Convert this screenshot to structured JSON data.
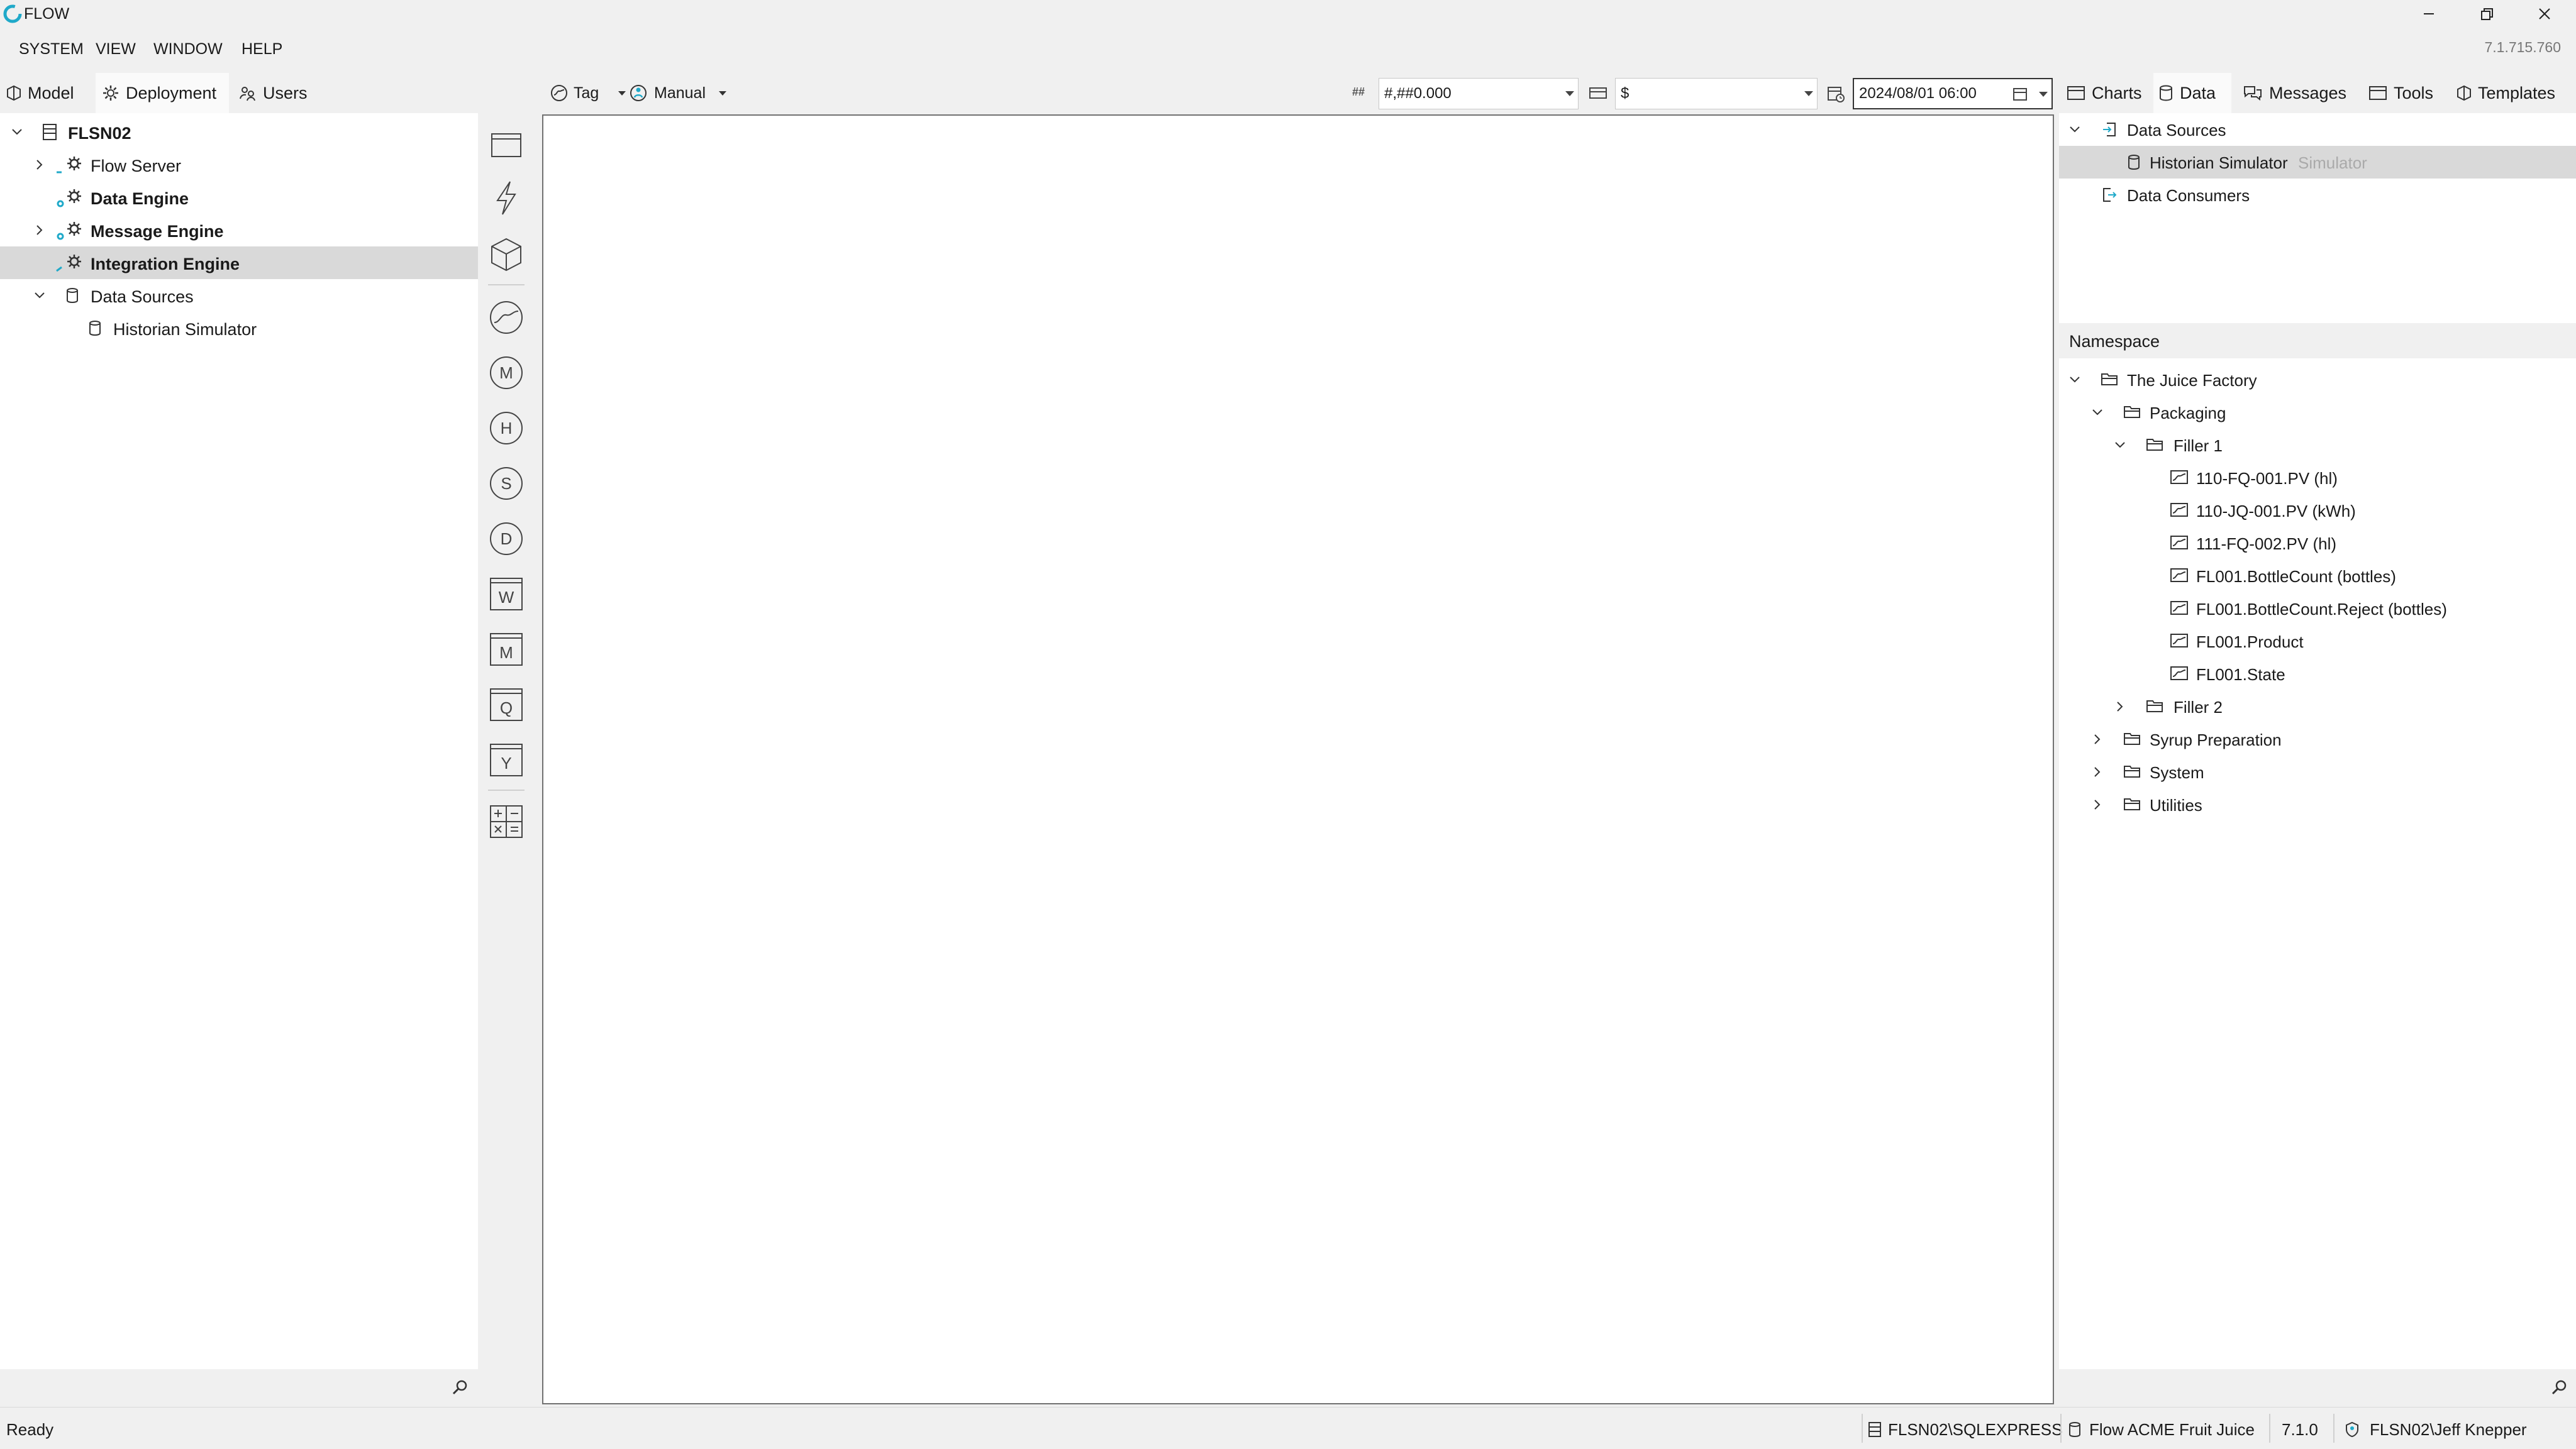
{
  "window": {
    "title": "FLOW",
    "version": "7.1.715.760"
  },
  "menu": [
    "SYSTEM",
    "VIEW",
    "WINDOW",
    "HELP"
  ],
  "left_tabs": [
    "Model",
    "Deployment",
    "Users"
  ],
  "left_tree": [
    {
      "label": "FLSN02",
      "bold": true
    },
    {
      "label": "Flow Server",
      "bold": false
    },
    {
      "label": "Data Engine",
      "bold": true
    },
    {
      "label": "Message Engine",
      "bold": true
    },
    {
      "label": "Integration Engine",
      "bold": true,
      "selected": true
    },
    {
      "label": "Data Sources",
      "bold": false
    },
    {
      "label": "Historian Simulator",
      "bold": false
    }
  ],
  "toolbar": {
    "tag_label": "Tag",
    "manual_label": "Manual",
    "format_value": "#,##0.000",
    "format_icon": "##",
    "currency_value": "$",
    "date_value": "2024/08/01 06:00"
  },
  "toolbox_icons": [
    "window-icon",
    "lightning-icon",
    "cube-icon",
    "trend-icon",
    "m-circle-icon",
    "h-circle-icon",
    "s-circle-icon",
    "d-circle-icon",
    "w-square-icon",
    "m-square-icon",
    "q-square-icon",
    "y-square-icon",
    "calculator-icon"
  ],
  "toolbox_letters": {
    "m1": "M",
    "h": "H",
    "s": "S",
    "d": "D",
    "w": "W",
    "m2": "M",
    "q": "Q",
    "y": "Y"
  },
  "right_tabs": [
    "Charts",
    "Data",
    "Messages",
    "Tools",
    "Templates"
  ],
  "data_tree": {
    "sources_label": "Data Sources",
    "source_item": "Historian Simulator",
    "source_type": "Simulator",
    "consumers_label": "Data Consumers"
  },
  "namespace": {
    "header": "Namespace",
    "root": "The Juice Factory",
    "packaging": "Packaging",
    "filler1": "Filler 1",
    "tags": [
      "110-FQ-001.PV (hl)",
      "110-JQ-001.PV (kWh)",
      "111-FQ-002.PV (hl)",
      "FL001.BottleCount (bottles)",
      "FL001.BottleCount.Reject (bottles)",
      "FL001.Product",
      "FL001.State"
    ],
    "filler2": "Filler 2",
    "syrup": "Syrup Preparation",
    "system": "System",
    "utilities": "Utilities"
  },
  "status": {
    "ready": "Ready",
    "sql": "FLSN02\\SQLEXPRESS",
    "database": "Flow ACME Fruit Juice",
    "version": "7.1.0",
    "user": "FLSN02\\Jeff Knepper"
  }
}
